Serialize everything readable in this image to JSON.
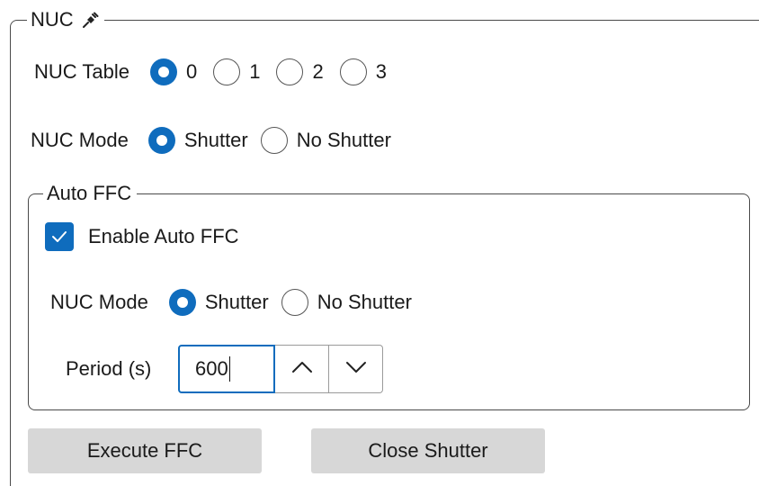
{
  "nuc_group": {
    "title": "NUC",
    "icon": "plug-icon",
    "nuc_table": {
      "label": "NUC Table",
      "options": [
        "0",
        "1",
        "2",
        "3"
      ],
      "selected": "0"
    },
    "nuc_mode": {
      "label": "NUC Mode",
      "options": [
        "Shutter",
        "No Shutter"
      ],
      "selected": "Shutter"
    }
  },
  "auto_ffc_group": {
    "title": "Auto FFC",
    "enable_label": "Enable Auto FFC",
    "enable_checked": true,
    "nuc_mode": {
      "label": "NUC Mode",
      "options": [
        "Shutter",
        "No Shutter"
      ],
      "selected": "Shutter"
    },
    "period": {
      "label": "Period (s)",
      "value": "600"
    }
  },
  "buttons": {
    "execute_ffc": "Execute FFC",
    "close_shutter": "Close Shutter"
  },
  "colors": {
    "accent": "#0f6cbd",
    "button_bg": "#d7d7d7",
    "border": "#4a4a4a"
  }
}
